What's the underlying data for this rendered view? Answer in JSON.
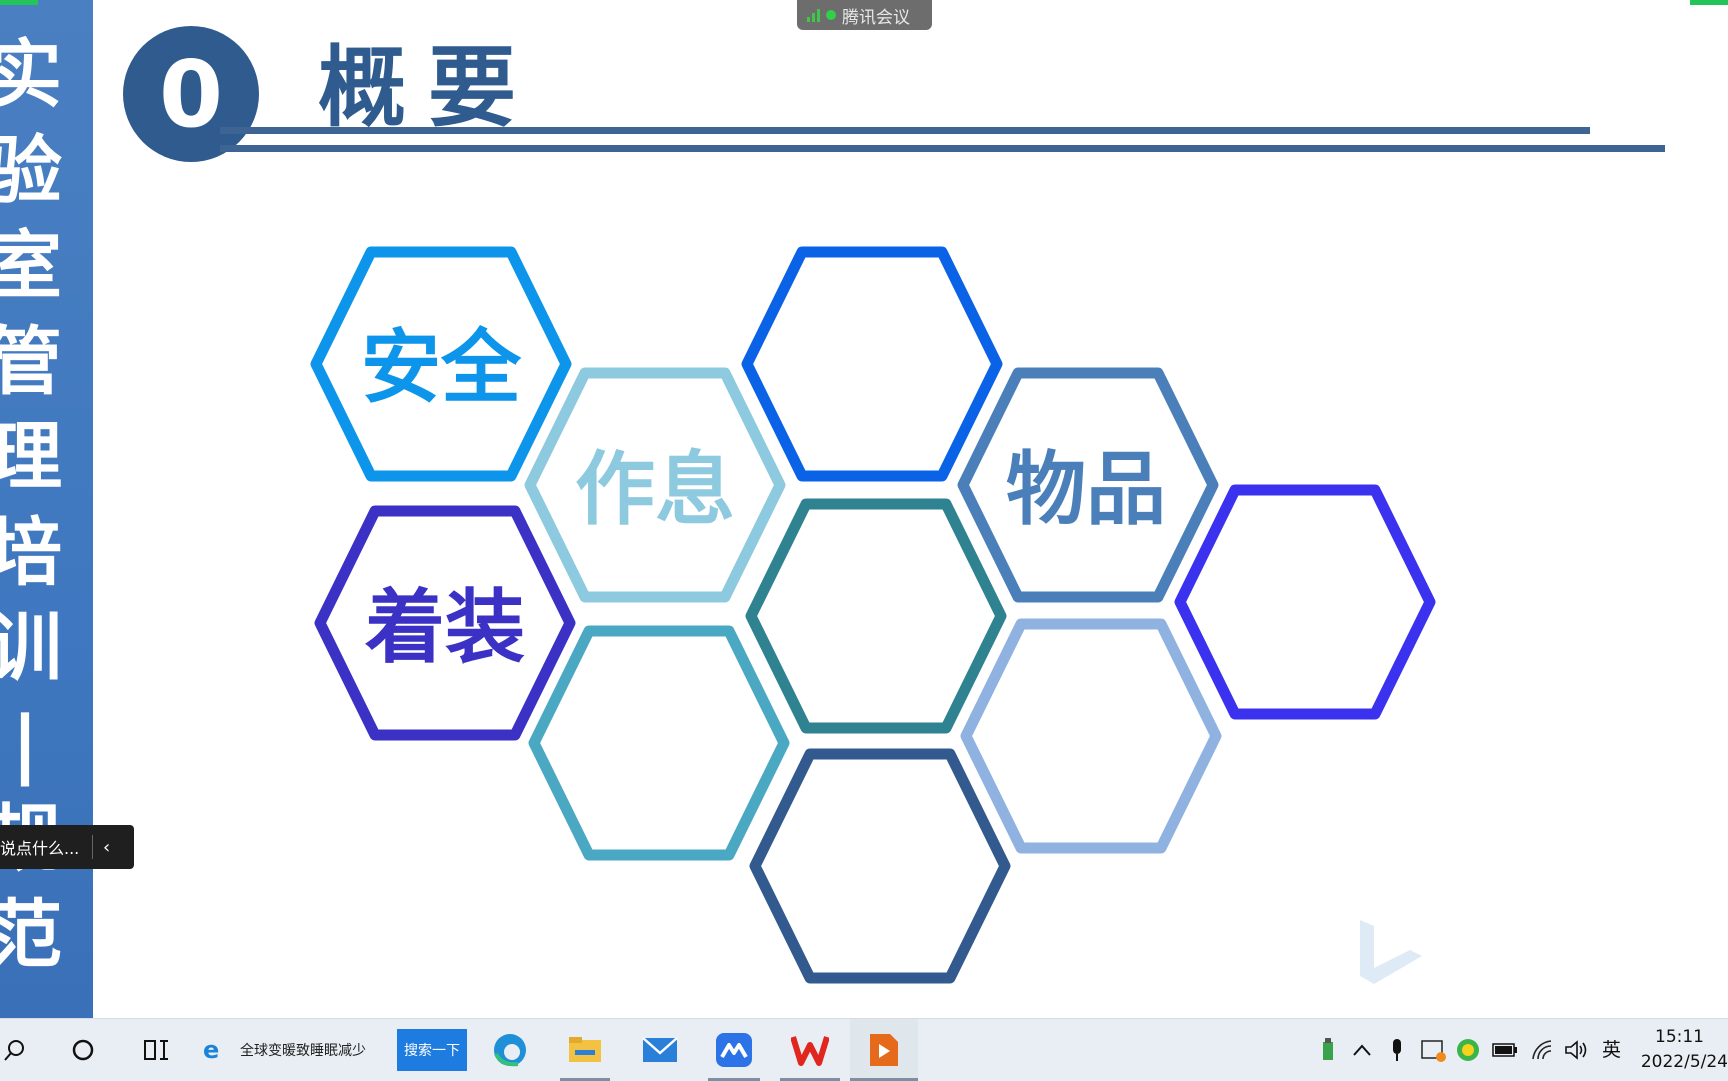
{
  "sidebar": {
    "title_chars": [
      "实",
      "验",
      "室",
      "管",
      "理",
      "培",
      "训",
      "|",
      "规",
      "范"
    ]
  },
  "meeting": {
    "label": "腾讯会议"
  },
  "header": {
    "number": "0",
    "title": "概要"
  },
  "hexagons": {
    "labels": {
      "safety": "安全",
      "schedule": "作息",
      "items": "物品",
      "attire": "着装"
    },
    "colors": {
      "safety": "#0c95ea",
      "schedule": "#8ecadf",
      "top_middle": "#0a63e6",
      "items": "#4b7fba",
      "attire": "#3b32c5",
      "center": "#2f8290",
      "right": "#3a32ee",
      "bottom_left": "#4aa8c3",
      "bottom_right": "#8fb2e0",
      "bottom": "#335a8f"
    }
  },
  "chat": {
    "placeholder": "说点什么..."
  },
  "taskbar": {
    "news": "全球变暖致睡眠减少",
    "search_button": "搜索一下",
    "ime": "英",
    "time": "15:11",
    "date": "2022/5/24"
  }
}
